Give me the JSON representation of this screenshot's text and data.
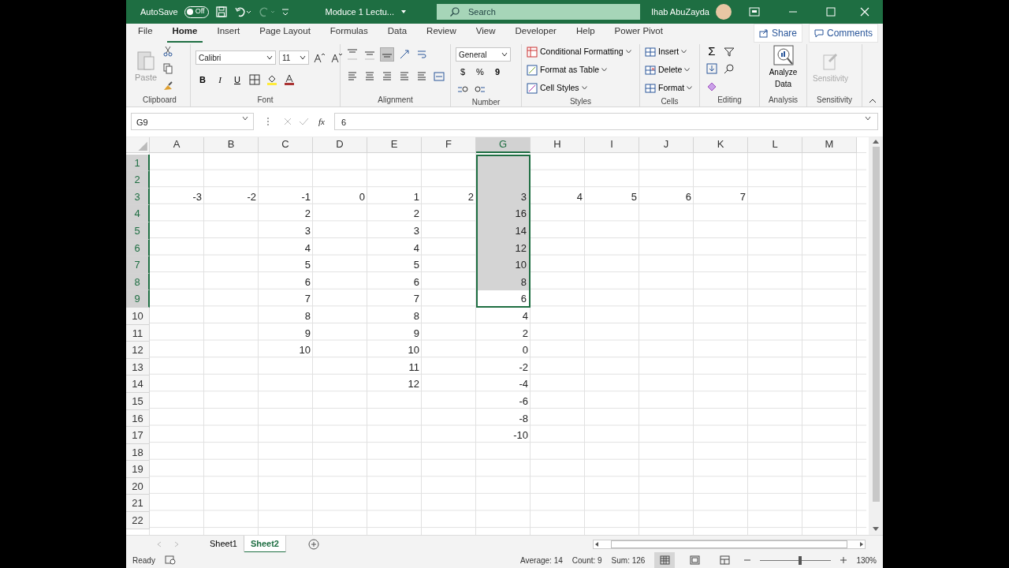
{
  "title_bar": {
    "autosave_label": "AutoSave",
    "autosave": {
      "on": false,
      "label": "Off"
    },
    "document_title": "Moduce 1 Lectu...",
    "search_placeholder": "Search",
    "user_name": "Ihab AbuZayda"
  },
  "menu_tabs": [
    {
      "label": "File",
      "selected": false
    },
    {
      "label": "Home",
      "selected": true
    },
    {
      "label": "Insert",
      "selected": false
    },
    {
      "label": "Page Layout",
      "selected": false
    },
    {
      "label": "Formulas",
      "selected": false
    },
    {
      "label": "Data",
      "selected": false
    },
    {
      "label": "Review",
      "selected": false
    },
    {
      "label": "View",
      "selected": false
    },
    {
      "label": "Developer",
      "selected": false
    },
    {
      "label": "Help",
      "selected": false
    },
    {
      "label": "Power Pivot",
      "selected": false
    }
  ],
  "share": "Share",
  "comments": "Comments",
  "ribbon": {
    "clipboard": {
      "name": "Clipboard",
      "paste": "Paste"
    },
    "font": {
      "name": "Font",
      "font_name": "Calibri",
      "font_size": "11",
      "bold": "B",
      "italic": "I",
      "underline": "U"
    },
    "alignment": {
      "name": "Alignment",
      "vertical": [
        {
          "selected": false
        },
        {
          "selected": false
        },
        {
          "selected": true
        }
      ]
    },
    "number": {
      "name": "Number",
      "format": "General",
      "currency": "$",
      "percent": "%",
      "comma": "9"
    },
    "styles": {
      "name": "Styles",
      "commands": [
        "Conditional Formatting",
        "Format as Table",
        "Cell Styles"
      ]
    },
    "cells": {
      "name": "Cells",
      "commands": [
        "Insert",
        "Delete",
        "Format"
      ]
    },
    "editing": {
      "name": "Editing",
      "sum": "Σ"
    },
    "analysis": {
      "name": "Analysis",
      "command": "Analyze Data"
    },
    "sensitivity": {
      "name": "Sensitivity",
      "command": "Sensitivity",
      "disabled": true
    }
  },
  "formula_bar": {
    "name_box": "G9",
    "fx": "fx",
    "value": "6"
  },
  "grid": {
    "columns": [
      {
        "label": "A",
        "selected": false
      },
      {
        "label": "B",
        "selected": false
      },
      {
        "label": "C",
        "selected": false
      },
      {
        "label": "D",
        "selected": false
      },
      {
        "label": "E",
        "selected": false
      },
      {
        "label": "F",
        "selected": false
      },
      {
        "label": "G",
        "selected": true
      },
      {
        "label": "H",
        "selected": false
      },
      {
        "label": "I",
        "selected": false
      },
      {
        "label": "J",
        "selected": false
      },
      {
        "label": "K",
        "selected": false
      },
      {
        "label": "L",
        "selected": false
      },
      {
        "label": "M",
        "selected": false
      }
    ],
    "rows": [
      {
        "number": "1",
        "selected": true,
        "cells": [
          null,
          null,
          null,
          null,
          null,
          null,
          null,
          null,
          null,
          null,
          null,
          null,
          null
        ]
      },
      {
        "number": "2",
        "selected": true,
        "cells": [
          null,
          null,
          null,
          null,
          null,
          null,
          null,
          null,
          null,
          null,
          null,
          null,
          null
        ]
      },
      {
        "number": "3",
        "selected": true,
        "cells": [
          "-3",
          "-2",
          "-1",
          "0",
          "1",
          "2",
          "3",
          "4",
          "5",
          "6",
          "7",
          null,
          null
        ]
      },
      {
        "number": "4",
        "selected": true,
        "cells": [
          null,
          null,
          "2",
          null,
          "2",
          null,
          "16",
          null,
          null,
          null,
          null,
          null,
          null
        ]
      },
      {
        "number": "5",
        "selected": true,
        "cells": [
          null,
          null,
          "3",
          null,
          "3",
          null,
          "14",
          null,
          null,
          null,
          null,
          null,
          null
        ]
      },
      {
        "number": "6",
        "selected": true,
        "cells": [
          null,
          null,
          "4",
          null,
          "4",
          null,
          "12",
          null,
          null,
          null,
          null,
          null,
          null
        ]
      },
      {
        "number": "7",
        "selected": true,
        "cells": [
          null,
          null,
          "5",
          null,
          "5",
          null,
          "10",
          null,
          null,
          null,
          null,
          null,
          null
        ]
      },
      {
        "number": "8",
        "selected": true,
        "cells": [
          null,
          null,
          "6",
          null,
          "6",
          null,
          "8",
          null,
          null,
          null,
          null,
          null,
          null
        ]
      },
      {
        "number": "9",
        "selected": true,
        "cells": [
          null,
          null,
          "7",
          null,
          "7",
          null,
          {
            "value": "6",
            "active": true
          },
          null,
          null,
          null,
          null,
          null,
          null
        ]
      },
      {
        "number": "10",
        "selected": false,
        "cells": [
          null,
          null,
          "8",
          null,
          "8",
          null,
          "4",
          null,
          null,
          null,
          null,
          null,
          null
        ]
      },
      {
        "number": "11",
        "selected": false,
        "cells": [
          null,
          null,
          "9",
          null,
          "9",
          null,
          "2",
          null,
          null,
          null,
          null,
          null,
          null
        ]
      },
      {
        "number": "12",
        "selected": false,
        "cells": [
          null,
          null,
          "10",
          null,
          "10",
          null,
          "0",
          null,
          null,
          null,
          null,
          null,
          null
        ]
      },
      {
        "number": "13",
        "selected": false,
        "cells": [
          null,
          null,
          null,
          null,
          "11",
          null,
          "-2",
          null,
          null,
          null,
          null,
          null,
          null
        ]
      },
      {
        "number": "14",
        "selected": false,
        "cells": [
          null,
          null,
          null,
          null,
          "12",
          null,
          "-4",
          null,
          null,
          null,
          null,
          null,
          null
        ]
      },
      {
        "number": "15",
        "selected": false,
        "cells": [
          null,
          null,
          null,
          null,
          null,
          null,
          "-6",
          null,
          null,
          null,
          null,
          null,
          null
        ]
      },
      {
        "number": "16",
        "selected": false,
        "cells": [
          null,
          null,
          null,
          null,
          null,
          null,
          "-8",
          null,
          null,
          null,
          null,
          null,
          null
        ]
      },
      {
        "number": "17",
        "selected": false,
        "cells": [
          null,
          null,
          null,
          null,
          null,
          null,
          "-10",
          null,
          null,
          null,
          null,
          null,
          null
        ]
      },
      {
        "number": "18",
        "selected": false,
        "cells": [
          null,
          null,
          null,
          null,
          null,
          null,
          null,
          null,
          null,
          null,
          null,
          null,
          null
        ]
      },
      {
        "number": "19",
        "selected": false,
        "cells": [
          null,
          null,
          null,
          null,
          null,
          null,
          null,
          null,
          null,
          null,
          null,
          null,
          null
        ]
      },
      {
        "number": "20",
        "selected": false,
        "cells": [
          null,
          null,
          null,
          null,
          null,
          null,
          null,
          null,
          null,
          null,
          null,
          null,
          null
        ]
      },
      {
        "number": "21",
        "selected": false,
        "cells": [
          null,
          null,
          null,
          null,
          null,
          null,
          null,
          null,
          null,
          null,
          null,
          null,
          null
        ]
      },
      {
        "number": "22",
        "selected": false,
        "cells": [
          null,
          null,
          null,
          null,
          null,
          null,
          null,
          null,
          null,
          null,
          null,
          null,
          null
        ]
      }
    ]
  },
  "sheet_tabs": [
    {
      "label": "Sheet1",
      "selected": false
    },
    {
      "label": "Sheet2",
      "selected": true
    }
  ],
  "status_bar": {
    "mode": "Ready",
    "average": "Average: 14",
    "count": "Count: 9",
    "sum": "Sum: 126",
    "views": [
      {
        "selected": true
      },
      {
        "selected": false
      },
      {
        "selected": false
      }
    ],
    "zoom": {
      "level": 0.56,
      "reading": "130%"
    }
  }
}
